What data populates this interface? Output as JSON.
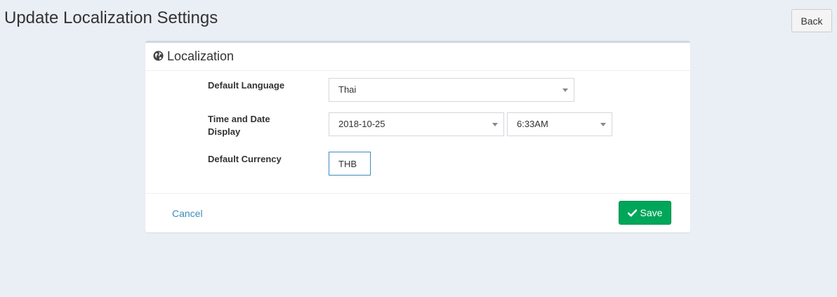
{
  "page": {
    "title": "Update Localization Settings",
    "back_label": "Back"
  },
  "panel": {
    "title": "Localization",
    "icon": "globe-icon"
  },
  "form": {
    "default_language": {
      "label": "Default Language",
      "value": "Thai"
    },
    "time_date_display": {
      "label_line1": "Time and Date",
      "label_line2": "Display",
      "date_value": "2018-10-25",
      "time_value": "6:33AM"
    },
    "default_currency": {
      "label": "Default Currency",
      "value": "THB"
    }
  },
  "footer": {
    "cancel_label": "Cancel",
    "save_label": "Save",
    "save_icon": "check-icon"
  },
  "colors": {
    "background": "#eaeef5",
    "link": "#3c8dbc",
    "save_button": "#00a65a",
    "input_focus_border": "#3c8dbc"
  }
}
